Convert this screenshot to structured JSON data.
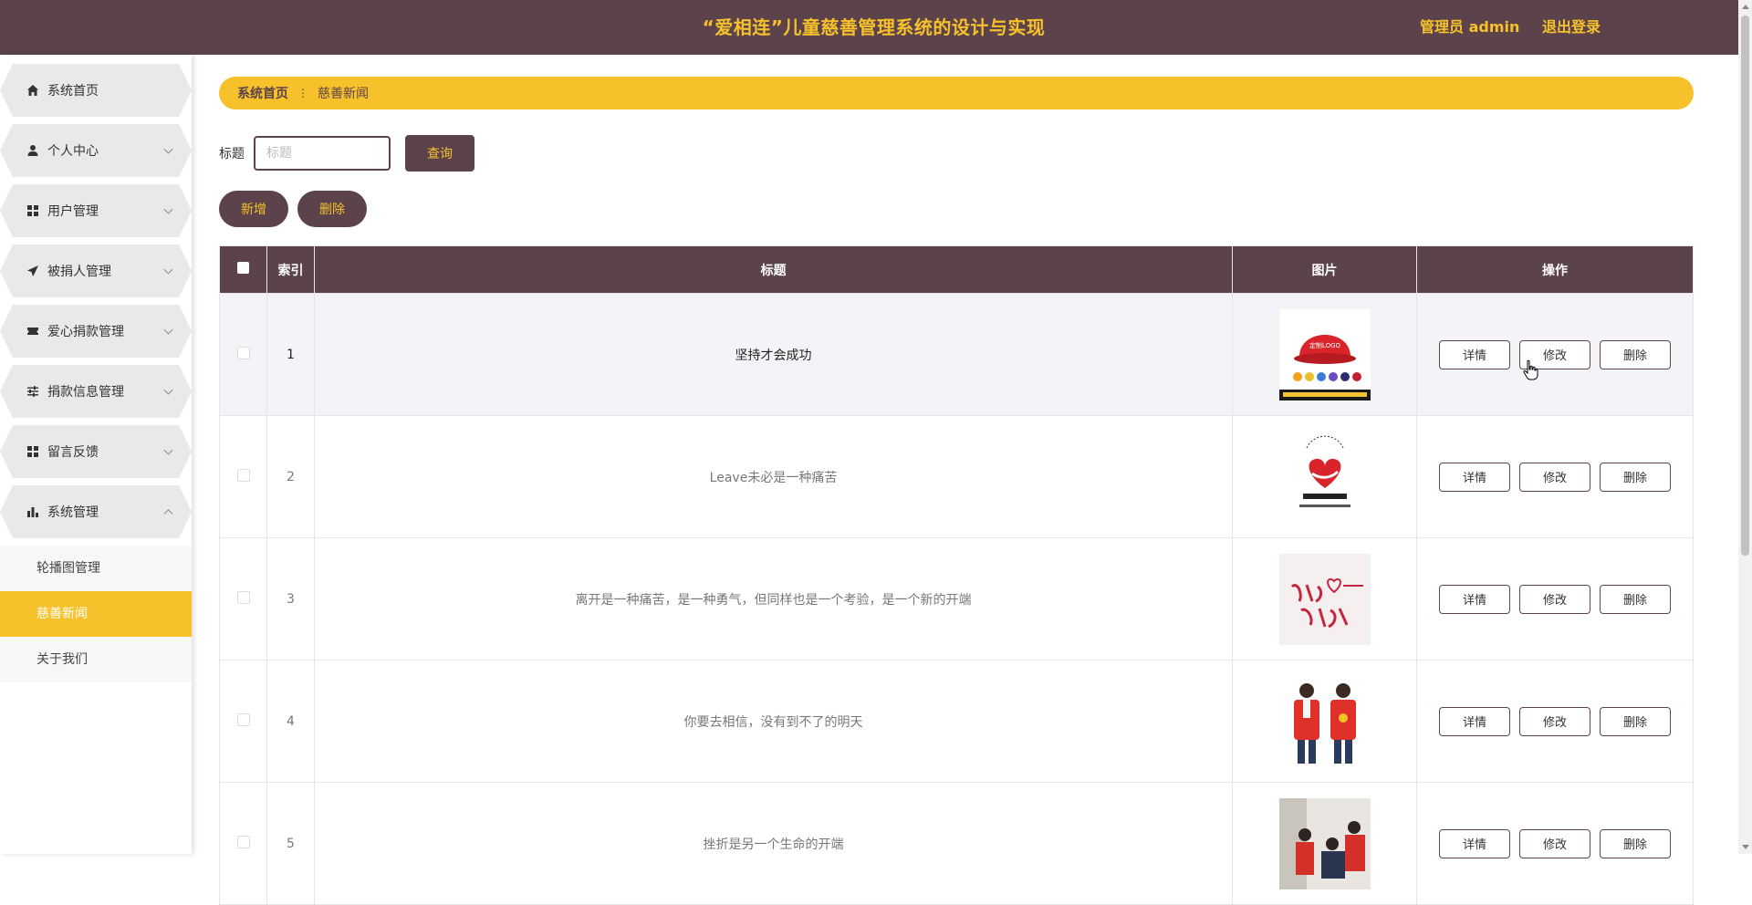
{
  "header": {
    "title": "“爱相连”儿童慈善管理系统的设计与实现",
    "admin_label": "管理员 admin",
    "logout_label": "退出登录"
  },
  "sidebar": {
    "items": [
      {
        "label": "系统首页",
        "icon": "home-icon",
        "expandable": false
      },
      {
        "label": "个人中心",
        "icon": "user-icon",
        "expandable": true
      },
      {
        "label": "用户管理",
        "icon": "grid-icon",
        "expandable": true
      },
      {
        "label": "被捐人管理",
        "icon": "send-icon",
        "expandable": true
      },
      {
        "label": "爱心捐款管理",
        "icon": "ticket-icon",
        "expandable": true
      },
      {
        "label": "捐款信息管理",
        "icon": "sliders-icon",
        "expandable": true
      },
      {
        "label": "留言反馈",
        "icon": "grid-icon",
        "expandable": true
      },
      {
        "label": "系统管理",
        "icon": "bar-chart-icon",
        "expandable": true,
        "expanded": true
      }
    ],
    "subitems": [
      {
        "label": "轮播图管理",
        "active": false
      },
      {
        "label": "慈善新闻",
        "active": true
      },
      {
        "label": "关于我们",
        "active": false
      }
    ]
  },
  "breadcrumb": {
    "home": "系统首页",
    "separator": "⋮",
    "current": "慈善新闻"
  },
  "search": {
    "label": "标题",
    "placeholder": "标题",
    "value": "",
    "button_label": "查询"
  },
  "actions": {
    "add_label": "新增",
    "delete_label": "删除"
  },
  "table": {
    "columns": [
      "",
      "索引",
      "标题",
      "图片",
      "操作"
    ],
    "op_labels": {
      "detail": "详情",
      "edit": "修改",
      "delete": "删除"
    },
    "rows": [
      {
        "index": "1",
        "title": "坚持才会成功",
        "image": "red-cap-image"
      },
      {
        "index": "2",
        "title": "Leave未必是一种痛苦",
        "image": "volunteer-association-logo-image"
      },
      {
        "index": "3",
        "title": "离开是一种痛苦，是一种勇气，但同样也是一个考验，是一个新的开端",
        "image": "i-am-volunteer-image"
      },
      {
        "index": "4",
        "title": "你要去相信，没有到不了的明天",
        "image": "red-vest-volunteers-image"
      },
      {
        "index": "5",
        "title": "挫折是另一个生命的开端",
        "image": "volunteers-visit-image"
      }
    ]
  },
  "colors": {
    "brand_dark": "#5c434b",
    "accent_yellow": "#f6c12b"
  }
}
